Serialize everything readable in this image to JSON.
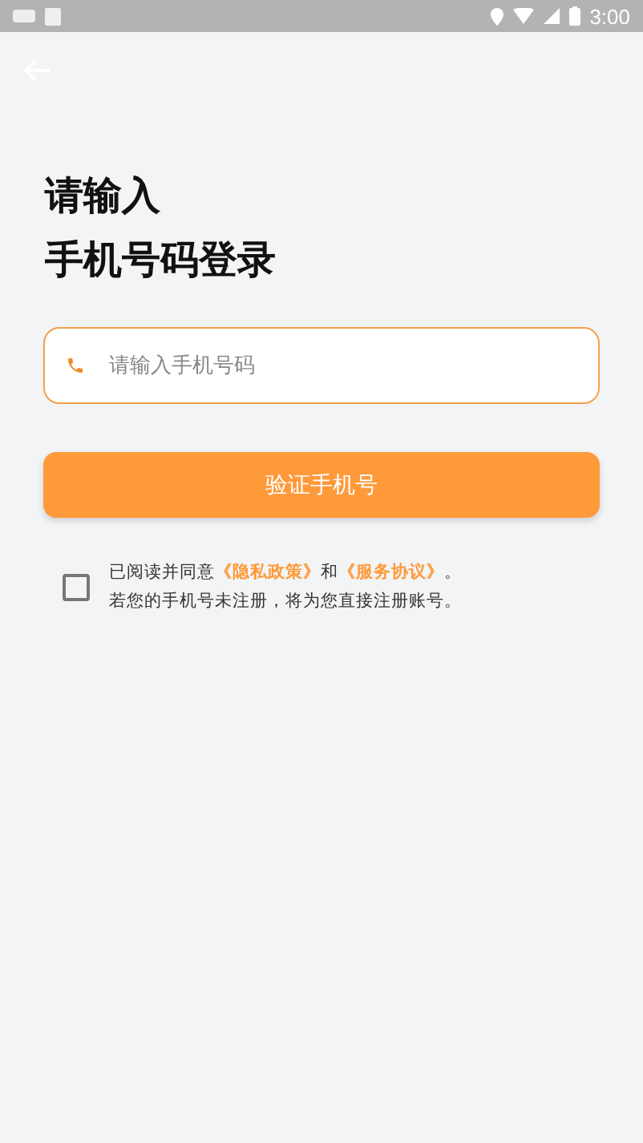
{
  "status_bar": {
    "time": "3:00"
  },
  "title_lines": [
    "请输入",
    "手机号码登录"
  ],
  "phone_field": {
    "placeholder": "请输入手机号码"
  },
  "submit_button": {
    "label": "验证手机号"
  },
  "agreement": {
    "checked": false,
    "parts": [
      {
        "kind": "text",
        "text": "已阅读并同意"
      },
      {
        "kind": "link",
        "text": "《隐私政策》"
      },
      {
        "kind": "text",
        "text": "和"
      },
      {
        "kind": "link",
        "text": "《服务协议》"
      },
      {
        "kind": "text",
        "text": "。"
      }
    ],
    "note": "若您的手机号未注册，将为您直接注册账号。"
  }
}
